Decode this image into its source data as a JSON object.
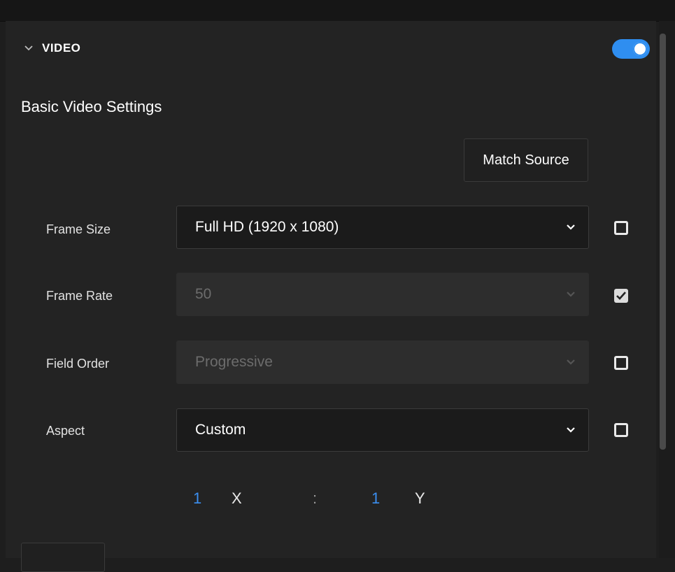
{
  "section": {
    "title": "VIDEO",
    "expanded_icon": "chevron-down-icon",
    "enabled": true,
    "accent_color": "#2f8ef0"
  },
  "group": {
    "title": "Basic Video Settings",
    "match_source_label": "Match Source"
  },
  "rows": [
    {
      "label": "Frame Size",
      "value": "Full HD (1920 x 1080)",
      "enabled": true,
      "checked": false
    },
    {
      "label": "Frame Rate",
      "value": "50",
      "enabled": false,
      "checked": true
    },
    {
      "label": "Field Order",
      "value": "Progressive",
      "enabled": false,
      "checked": false
    },
    {
      "label": "Aspect",
      "value": "Custom",
      "enabled": true,
      "checked": false
    }
  ],
  "aspect_ratio": {
    "x_value": "1",
    "x_label": "X",
    "separator": ":",
    "y_value": "1",
    "y_label": "Y"
  }
}
